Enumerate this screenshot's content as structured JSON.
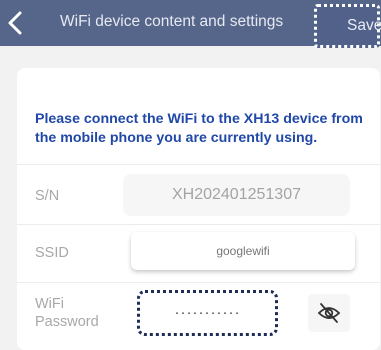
{
  "header": {
    "back_icon": "chevron-left-icon",
    "title": "WiFi device content and settings",
    "save_label": "Save",
    "background": "#56668a"
  },
  "form": {
    "notice": "Please connect the WiFi to the XH13 device from the mobile phone you are currently using.",
    "sn": {
      "label": "S/N",
      "value": "XH202401251307"
    },
    "ssid": {
      "label": "SSID",
      "value": "googlewifi"
    },
    "password": {
      "label_line1": "WiFi",
      "label_line2": "Password",
      "value": "···········",
      "toggle_icon": "eye-off-icon"
    }
  },
  "colors": {
    "notice_text": "#2048a8",
    "label_text": "#a8a8a8"
  }
}
